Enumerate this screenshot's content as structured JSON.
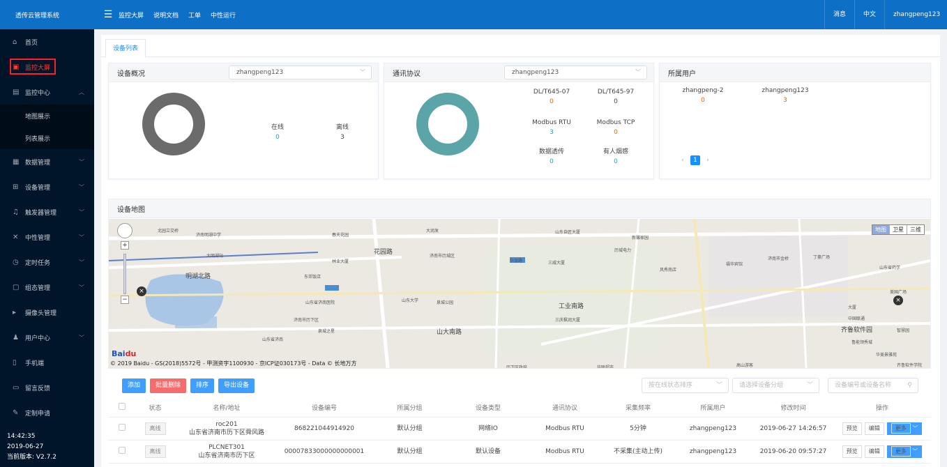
{
  "app": {
    "title": "透传云管理系统"
  },
  "topnav": [
    "监控大屏",
    "说明文档",
    "工单",
    "中性运行"
  ],
  "topright": {
    "messages": "消息",
    "language": "中文",
    "user": "zhangpeng123"
  },
  "sidebar": {
    "items": [
      {
        "label": "首页"
      },
      {
        "label": "监控大屏"
      },
      {
        "label": "监控中心"
      },
      {
        "label": "地图展示"
      },
      {
        "label": "列表展示"
      },
      {
        "label": "数据管理"
      },
      {
        "label": "设备管理"
      },
      {
        "label": "触发器管理"
      },
      {
        "label": "中性管理"
      },
      {
        "label": "定时任务"
      },
      {
        "label": "组态管理"
      },
      {
        "label": "摄像头管理"
      },
      {
        "label": "用户中心"
      },
      {
        "label": "手机端"
      },
      {
        "label": "留言反馈"
      },
      {
        "label": "定制申请"
      }
    ],
    "footer": {
      "time": "14:42:35",
      "date": "2019-06-27",
      "version": "当前版本: V2.7.2"
    }
  },
  "tabs": {
    "active": "设备列表"
  },
  "overview": {
    "title": "设备概况",
    "select": "zhangpeng123",
    "online_label": "在线",
    "online_value": "0",
    "offline_label": "离线",
    "offline_value": "3",
    "donut_color": "#6b6b6b"
  },
  "protocol": {
    "title": "通讯协议",
    "select": "zhangpeng123",
    "donut_color": "#5ba4a8",
    "items": [
      {
        "label": "DL/T645-07",
        "value": "0"
      },
      {
        "label": "DL/T645-97",
        "value": "0"
      },
      {
        "label": "Modbus RTU",
        "value": "3"
      },
      {
        "label": "Modbus TCP",
        "value": "0"
      },
      {
        "label": "数据透传",
        "value": "0"
      },
      {
        "label": "有人烟感",
        "value": "0"
      }
    ]
  },
  "users": {
    "title": "所属用户",
    "items": [
      {
        "label": "zhangpeng-2",
        "value": "0"
      },
      {
        "label": "zhangpeng123",
        "value": "3"
      }
    ],
    "page": "1"
  },
  "map": {
    "title": "设备地图",
    "types": [
      "地图",
      "卫星",
      "三维"
    ],
    "copyright": "© 2019 Baidu - GS(2018)5572号 - 甲测资字1100930 - 京ICP证030173号 - Data © 长地万方",
    "labels": [
      "北园立交桥",
      "济南明湖中学",
      "春天花园",
      "大润发",
      "山东自匠大厦",
      "新馨家园",
      "大明湖站",
      "花园路",
      "济南市历城区",
      "历城电力",
      "明湖北路",
      "林业大厦",
      "东郊饭店",
      "华龙路",
      "三威大厦",
      "风秀南店",
      "福华宾馆",
      "济南市金桥",
      "丁豪广场",
      "山东省药学",
      "山东省济南医院",
      "山东大学",
      "泉城公园",
      "工业南路",
      "中国联通",
      "齐鲁软件园",
      "山大南路",
      "济南市历下区",
      "三庆枫润大厦",
      "鲁能领秀城",
      "山东省济南",
      "泉城之星",
      "华联超市",
      "高山游客",
      "历下区政府",
      "齐鲁软件学院",
      "大厦",
      "美国广场",
      "智慧园",
      "华美景雅苑"
    ]
  },
  "toolbar": {
    "add": "添加",
    "batch_delete": "批量删除",
    "sort": "排序",
    "export": "导出设备"
  },
  "filters": {
    "sort_status": "按在线状态排序",
    "group": "请选择设备分组",
    "search": "设备编号或设备名称"
  },
  "table": {
    "headers": [
      "状态",
      "名称/地址",
      "设备编号",
      "所属分组",
      "设备类型",
      "通讯协议",
      "采集频率",
      "所属用户",
      "修改时间",
      "操作"
    ],
    "rows": [
      {
        "status": "离线",
        "name": "roc201",
        "address": "山东省济南市历下区舜风路",
        "id": "868221044914920",
        "group": "默认分组",
        "type": "网络IO",
        "protocol": "Modbus RTU",
        "freq": "5分钟",
        "user": "zhangpeng123",
        "time": "2019-06-27 14:26:57"
      },
      {
        "status": "离线",
        "name": "PLCNET301",
        "address": "山东省济南市历下区",
        "id": "00007833000000000001",
        "group": "默认分组",
        "type": "默认设备",
        "protocol": "Modbus RTU",
        "freq": "不采集(主动上传)",
        "user": "zhangpeng123",
        "time": "2019-06-20 09:57:27"
      }
    ],
    "ops": {
      "preview": "预览",
      "edit": "编辑",
      "more": "更多"
    }
  }
}
